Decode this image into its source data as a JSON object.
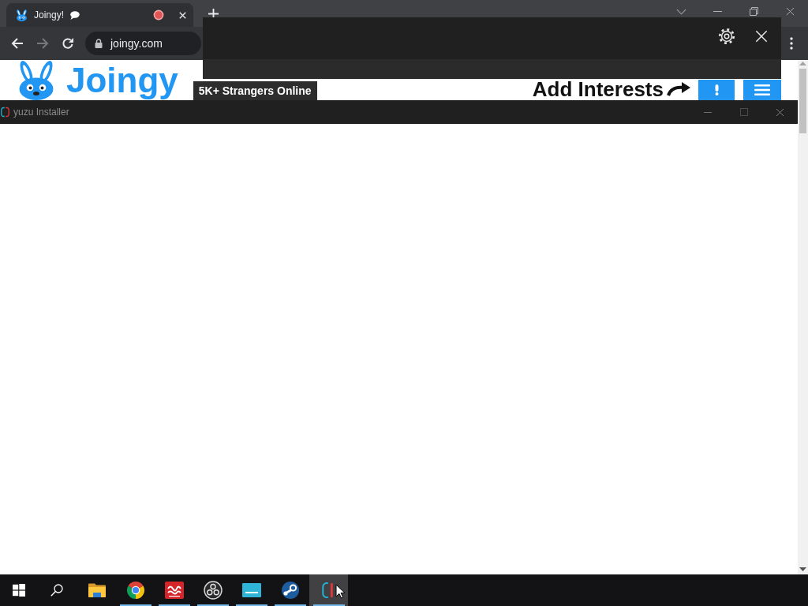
{
  "browser": {
    "tabs": [
      {
        "title": "Joingy!",
        "selected": true,
        "recording": true
      }
    ],
    "address_bar": {
      "value": "joingy.com"
    },
    "page": {
      "logo": "Joingy",
      "online_count": "5K+ Strangers Online",
      "interests_label": "Add Interests"
    }
  },
  "installer_window": {
    "title": "yuzu Installer"
  },
  "taskbar": {
    "apps": [
      {
        "kind": "folder",
        "running": false,
        "selected": false
      },
      {
        "kind": "browser",
        "running": true,
        "selected": false
      },
      {
        "kind": "video",
        "running": true,
        "selected": false
      },
      {
        "kind": "recorder",
        "running": true,
        "selected": false
      },
      {
        "kind": "display",
        "running": true,
        "selected": false
      },
      {
        "kind": "game-store",
        "running": true,
        "selected": false
      },
      {
        "kind": "emulator",
        "running": true,
        "selected": true
      }
    ]
  }
}
